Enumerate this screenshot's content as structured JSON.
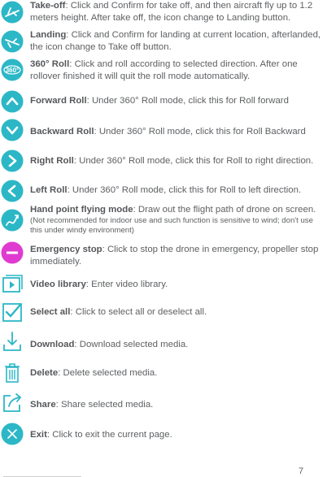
{
  "colors": {
    "accent": "#2cb7c6",
    "stop": "#e03bd0",
    "text": "#5e6063"
  },
  "items": [
    {
      "icon": "takeoff-icon",
      "title": "Take-off",
      "desc": ": Click and Confirm for take off, and then aircraft fly up to 1.2 meters height. After take off, the icon change to Landing button."
    },
    {
      "icon": "landing-icon",
      "title": "Landing",
      "desc": ": Click and Confirm for landing at current location, afterlanded, the icon change to Take off button."
    },
    {
      "icon": "roll-360-icon",
      "icon_text": "360°",
      "title": "360° Roll",
      "desc": ": Click and roll according to selected direction. After one rollover finished it will quit the roll mode automatically."
    },
    {
      "icon": "forward-roll-icon",
      "title": "Forward Roll",
      "desc": ": Under 360° Roll mode, click this for Roll forward"
    },
    {
      "icon": "backward-roll-icon",
      "title": "Backward Roll",
      "desc": ": Under 360° Roll mode, click this for Roll Backward"
    },
    {
      "icon": "right-roll-icon",
      "title": "Right Roll",
      "desc": ": Under 360° Roll mode, click this for Roll to right direction."
    },
    {
      "icon": "left-roll-icon",
      "title": "Left Roll",
      "desc": ": Under 360° Roll mode, click this for Roll to left direction."
    },
    {
      "icon": "hand-point-flying-icon",
      "title": "Hand point flying mode",
      "desc": ": Draw out the flight path of drone on screen.",
      "note": "(Not recommended for indoor use and such function is sensitive to wind; don't use this under windy environment)"
    },
    {
      "icon": "emergency-stop-icon",
      "title": "Emergency stop",
      "desc": ": Click to stop the drone in emergency, propeller stop immediately."
    },
    {
      "icon": "video-library-icon",
      "title": "Video library",
      "desc": ": Enter video library."
    },
    {
      "icon": "select-all-icon",
      "title": "Select all",
      "desc": ": Click to select all or deselect all."
    },
    {
      "icon": "download-icon",
      "title": "Download",
      "desc": ": Download selected media."
    },
    {
      "icon": "delete-icon",
      "title": "Delete",
      "desc": ": Delete selected media."
    },
    {
      "icon": "share-icon",
      "title": "Share",
      "desc": ": Share selected media."
    },
    {
      "icon": "exit-icon",
      "title": "Exit",
      "desc": ": Click to exit the current page."
    }
  ],
  "page_number": "7"
}
